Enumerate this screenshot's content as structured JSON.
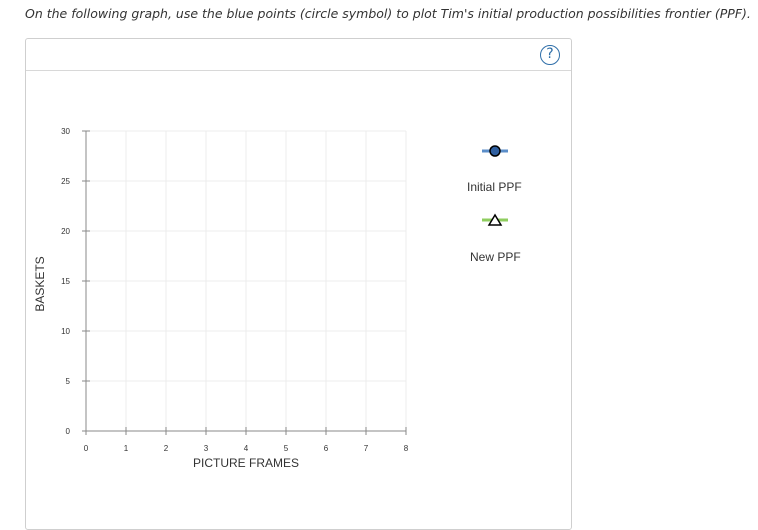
{
  "instruction": "On the following graph, use the blue points (circle symbol) to plot Tim's initial production possibilities frontier (PPF).",
  "help_symbol": "?",
  "help_icon": "question-circle-icon",
  "chart_data": {
    "type": "scatter",
    "xlabel": "PICTURE FRAMES",
    "ylabel": "BASKETS",
    "xlim": [
      0,
      8
    ],
    "ylim": [
      0,
      30
    ],
    "x_ticks": [
      "0",
      "1",
      "2",
      "3",
      "4",
      "5",
      "6",
      "7",
      "8"
    ],
    "y_ticks": [
      "0",
      "5",
      "10",
      "15",
      "20",
      "25",
      "30"
    ],
    "grid": true,
    "legend_placement": "right",
    "series": [
      {
        "name": "Initial PPF",
        "marker": "circle",
        "color": "#5b8ec9",
        "marker_fill": "#2f5fa0",
        "points": []
      },
      {
        "name": "New PPF",
        "marker": "triangle",
        "color": "#8fcd5f",
        "marker_fill": "#ffffff",
        "points": []
      }
    ]
  }
}
